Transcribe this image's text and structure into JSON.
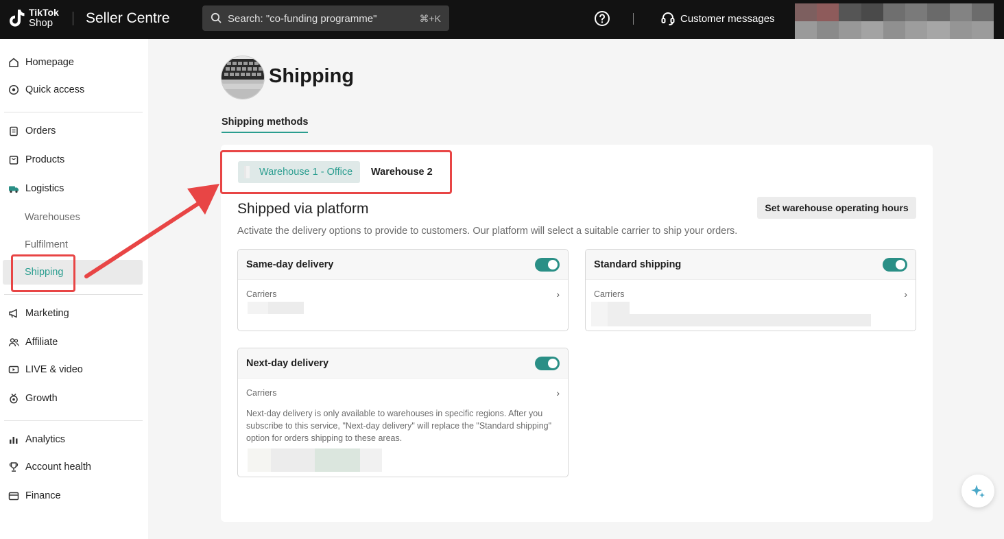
{
  "topbar": {
    "logo_line1": "TikTok",
    "logo_line2": "Shop",
    "app_title": "Seller Centre",
    "search_placeholder": "Search: \"co-funding programme\"",
    "search_shortcut": "⌘+K",
    "customer_messages": "Customer messages"
  },
  "sidebar": {
    "homepage": "Homepage",
    "quick_access": "Quick access",
    "orders": "Orders",
    "products": "Products",
    "logistics": "Logistics",
    "warehouses": "Warehouses",
    "fulfilment": "Fulfilment",
    "shipping": "Shipping",
    "marketing": "Marketing",
    "affiliate": "Affiliate",
    "live_video": "LIVE & video",
    "growth": "Growth",
    "analytics": "Analytics",
    "account_health": "Account health",
    "finance": "Finance"
  },
  "main": {
    "title": "Shipping",
    "tab": "Shipping methods",
    "warehouse_tabs": [
      "Warehouse 1 - Office",
      "Warehouse 2"
    ],
    "section_title": "Shipped via platform",
    "hours_button": "Set warehouse operating hours",
    "section_desc": "Activate the delivery options to provide to customers. Our platform will select a suitable carrier to ship your orders.",
    "options": {
      "same_day": {
        "name": "Same-day delivery",
        "carriers": "Carriers",
        "enabled": true
      },
      "standard": {
        "name": "Standard shipping",
        "carriers": "Carriers",
        "enabled": true
      },
      "next_day": {
        "name": "Next-day delivery",
        "carriers": "Carriers",
        "enabled": true,
        "note": "Next-day delivery is only available to warehouses in specific regions. After you subscribe to this service, \"Next-day delivery\" will replace the \"Standard shipping\" option for orders shipping to these areas."
      }
    }
  },
  "colors": {
    "accent": "#2a9d8f",
    "toggle": "#2a8f86",
    "highlight": "#e84545",
    "topbar": "#121212"
  }
}
